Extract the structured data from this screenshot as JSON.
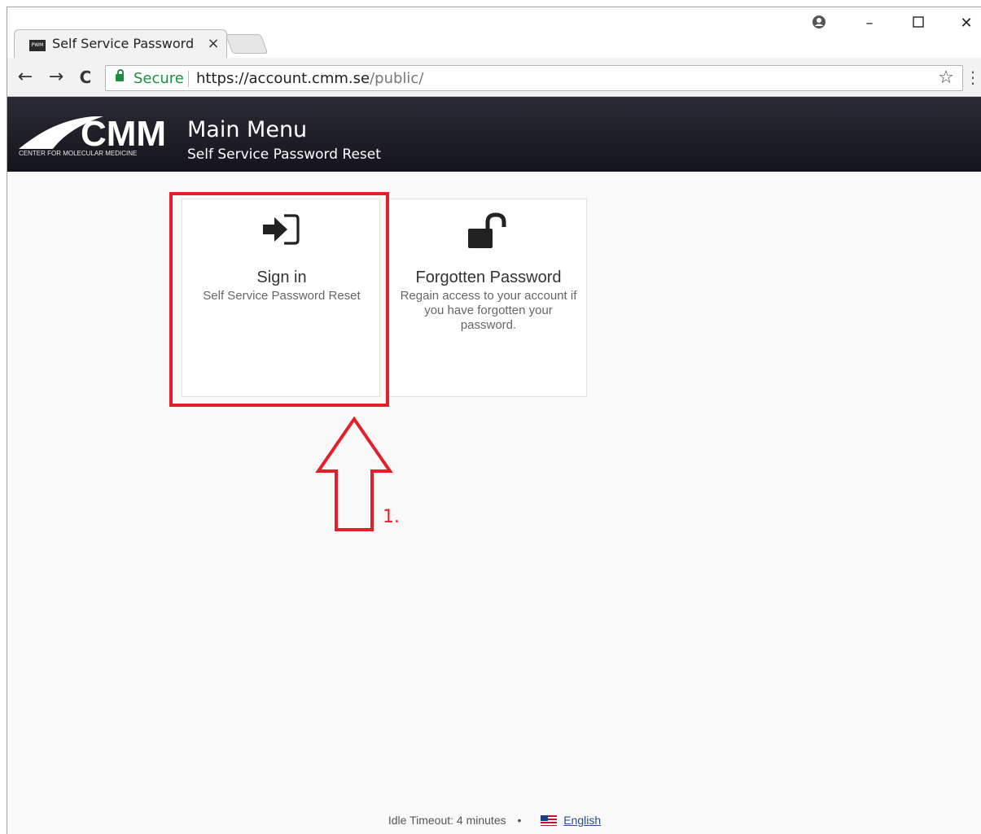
{
  "browser": {
    "tab": {
      "title": "Self Service Password Res",
      "favicon_label": "PWM"
    },
    "window_controls": {
      "profile": "❶",
      "minimize": "–",
      "maximize": "☐",
      "close": "✕"
    },
    "toolbar": {
      "back": "←",
      "forward": "→",
      "reload": "C",
      "secure_label": "Secure",
      "url_host": "https://account.cmm.se",
      "url_path": "/public/",
      "bookmark_star": "☆",
      "menu": "⋮"
    }
  },
  "header": {
    "logo_text": "CMM",
    "logo_subtext": "CENTER FOR MOLECULAR MEDICINE",
    "title": "Main Menu",
    "subtitle": "Self Service Password Reset"
  },
  "cards": [
    {
      "icon": "sign-in-icon",
      "title": "Sign in",
      "description": "Self Service Password Reset"
    },
    {
      "icon": "unlock-icon",
      "title": "Forgotten Password",
      "description": "Regain access to your account if you have forgotten your password."
    }
  ],
  "annotation": {
    "label": "1.",
    "color": "#e3202a"
  },
  "footer": {
    "idle_timeout": "Idle Timeout: 4 minutes",
    "separator": "•",
    "language": "English"
  }
}
